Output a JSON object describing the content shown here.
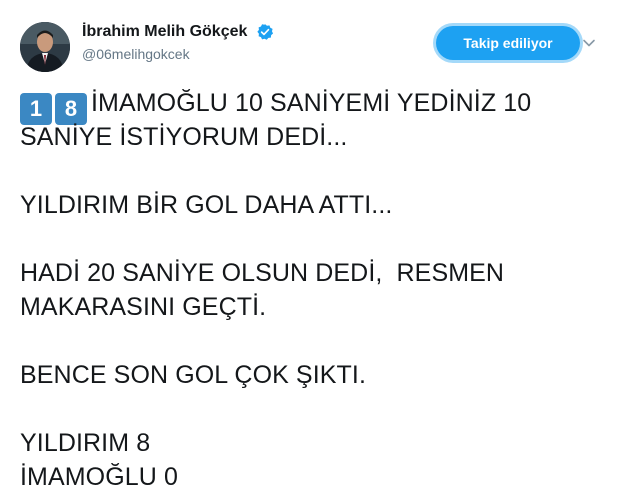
{
  "author": {
    "display_name": "İbrahim Melih Gökçek",
    "handle": "@06melihgokcek",
    "verified": true
  },
  "follow_button": {
    "label": "Takip ediliyor"
  },
  "colors": {
    "brand_blue": "#1da1f2",
    "keycap_blue": "#3b88c3",
    "text": "#14171a",
    "secondary_text": "#657786"
  },
  "icons": {
    "verified": "verified-badge-icon",
    "menu": "chevron-down-icon",
    "keycap_1": "keycap-digit-one",
    "keycap_8": "keycap-digit-eight"
  },
  "tweet": {
    "keycaps": [
      "1",
      "8"
    ],
    "line1": "İMAMOĞLU 10 SANİYEMİ YEDİNİZ 10",
    "line2": "SANİYE İSTİYORUM DEDİ...",
    "line3": "YILDIRIM BİR GOL DAHA ATTI...",
    "line4": "HADİ 20 SANİYE OLSUN DEDİ,  RESMEN",
    "line5": "MAKARASINI GEÇTİ.",
    "line6": "BENCE SON GOL ÇOK ŞIKTI.",
    "line7": "YILDIRIM 8",
    "line8": "İMAMOĞLU 0"
  }
}
